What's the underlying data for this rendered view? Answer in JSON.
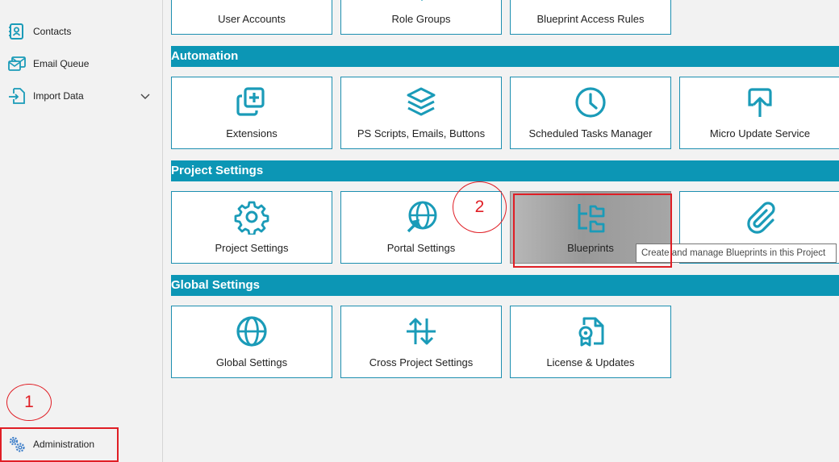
{
  "sidebar": {
    "items": [
      {
        "label": "Contacts",
        "icon": "contacts-icon"
      },
      {
        "label": "Email Queue",
        "icon": "email-queue-icon"
      },
      {
        "label": "Import Data",
        "icon": "import-icon"
      }
    ],
    "footer": {
      "label": "Administration",
      "icon": "gears-icon"
    }
  },
  "sections": {
    "top_row": [
      "User Accounts",
      "Role Groups",
      "Blueprint Access Rules"
    ],
    "automation": {
      "title": "Automation",
      "tiles": [
        "Extensions",
        "PS Scripts, Emails, Buttons",
        "Scheduled Tasks Manager",
        "Micro Update Service"
      ]
    },
    "project_settings": {
      "title": "Project Settings",
      "tiles": [
        "Project Settings",
        "Portal Settings",
        "Blueprints",
        ""
      ]
    },
    "global_settings": {
      "title": "Global Settings",
      "tiles": [
        "Global Settings",
        "Cross Project Settings",
        "License & Updates"
      ]
    }
  },
  "tooltip": "Create and manage Blueprints in this Project",
  "annotations": {
    "step1": "1",
    "step2": "2"
  },
  "colors": {
    "accent": "#0c96b5",
    "icon": "#1a9bb8",
    "annotation": "#e01e25"
  }
}
